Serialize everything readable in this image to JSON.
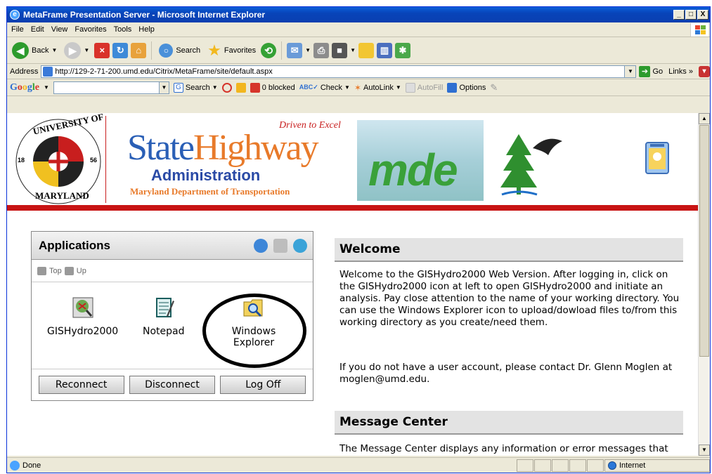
{
  "window": {
    "title": "MetaFrame Presentation Server - Microsoft Internet Explorer",
    "controls": [
      "_",
      "□",
      "X"
    ]
  },
  "menu": [
    "File",
    "Edit",
    "View",
    "Favorites",
    "Tools",
    "Help"
  ],
  "toolbar": {
    "back": "Back",
    "search": "Search",
    "favorites": "Favorites"
  },
  "address": {
    "label": "Address",
    "url": "http://129-2-71-200.umd.edu/Citrix/MetaFrame/site/default.aspx",
    "go": "Go",
    "links": "Links"
  },
  "google": {
    "logo": "Google",
    "search": "Search",
    "blocked": "0 blocked",
    "check": "Check",
    "autolink": "AutoLink",
    "autofill": "AutoFill",
    "options": "Options"
  },
  "banner": {
    "seal_top": "UNIVERSITY OF",
    "seal_bottom": "MARYLAND",
    "seal_left": "18",
    "seal_right": "56",
    "sha_state": "State",
    "sha_highway": "Highway",
    "sha_tagline": "Driven to Excel",
    "sha_admin": "Administration",
    "sha_dept": "Maryland Department of Transportation",
    "mde": "mde"
  },
  "applications": {
    "title": "Applications",
    "crumb_top": "Top",
    "crumb_up": "Up",
    "apps": [
      {
        "label": "GISHydro2000"
      },
      {
        "label": "Notepad"
      },
      {
        "label": "Windows Explorer"
      }
    ],
    "buttons": {
      "reconnect": "Reconnect",
      "disconnect": "Disconnect",
      "logoff": "Log Off"
    }
  },
  "welcome": {
    "title": "Welcome",
    "para1": "Welcome to the GISHydro2000 Web Version. After logging in, click on the GISHydro2000 icon at left to open GISHydro2000 and initiate an analysis. Pay close attention to the name of your working directory. You can use the Windows Explorer icon to upload/dowload files to/from this working directory as you create/need them.",
    "para2": "If you do not have a user account, please contact Dr. Glenn Moglen at moglen@umd.edu."
  },
  "message_center": {
    "title": "Message Center",
    "text": "The Message Center displays any information or error messages that"
  },
  "status": {
    "text": "Done",
    "zone": "Internet"
  }
}
